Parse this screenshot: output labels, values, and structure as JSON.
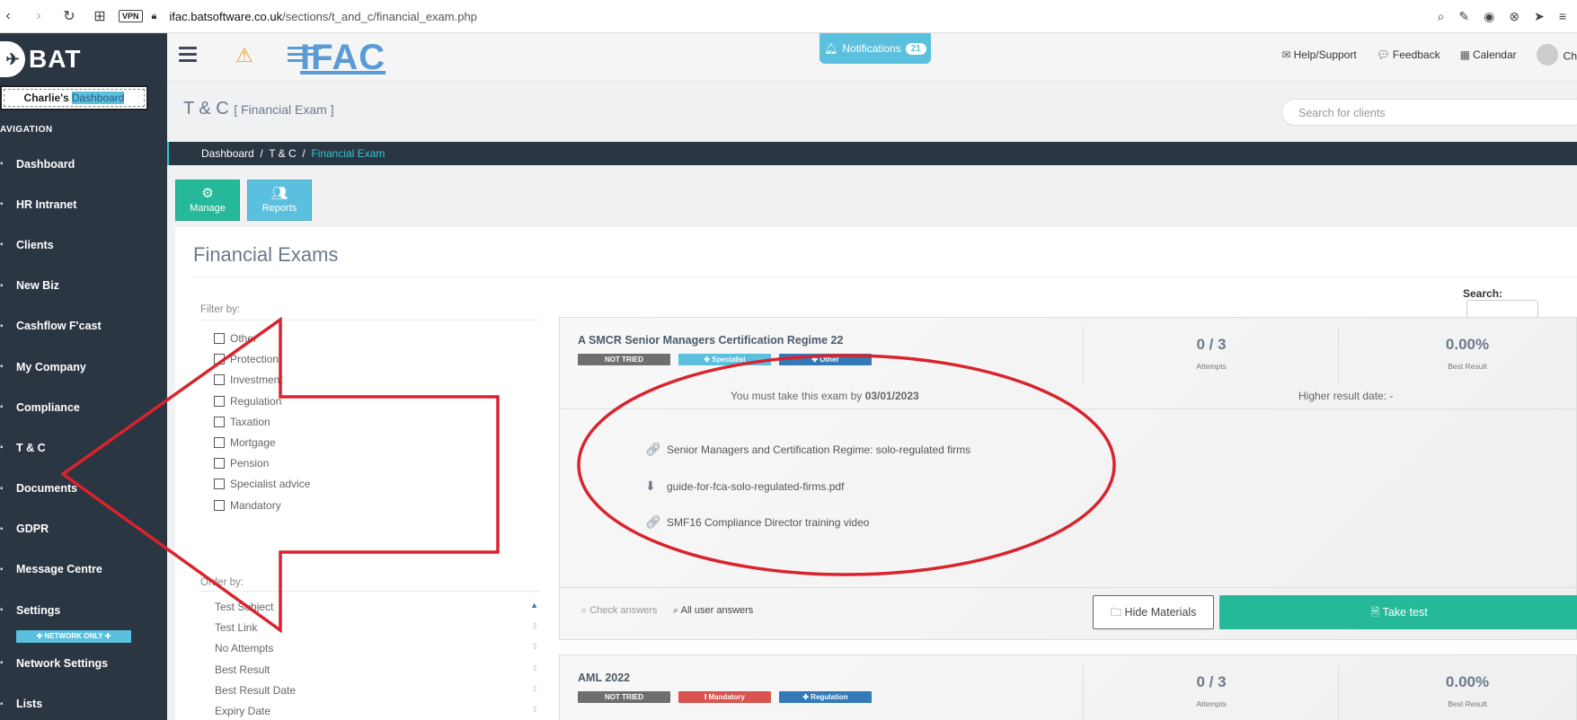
{
  "browser": {
    "url_host": "ifac.batsoftware.co.uk",
    "url_path": "/sections/t_and_c/financial_exam.php",
    "vpn_label": "VPN"
  },
  "sidebar": {
    "logo": "BAT",
    "dashboard_button": {
      "owner": "Charlie's",
      "label": "Dashboard"
    },
    "nav_heading": "AVIGATION",
    "items": [
      {
        "label": "Dashboard",
        "icon": "monitor-icon"
      },
      {
        "label": "HR Intranet",
        "icon": "hr-icon"
      },
      {
        "label": "Clients",
        "icon": "users-icon"
      },
      {
        "label": "New Biz",
        "icon": "sign-in-icon"
      },
      {
        "label": "Cashflow F'cast",
        "icon": "chart-icon"
      },
      {
        "label": "My Company",
        "icon": "building-icon"
      },
      {
        "label": "Compliance",
        "icon": "check-icon"
      },
      {
        "label": "T & C",
        "icon": "graduation-icon"
      },
      {
        "label": "Documents",
        "icon": "file-icon"
      },
      {
        "label": "GDPR",
        "icon": "shield-icon"
      },
      {
        "label": "Message Centre",
        "icon": "envelope-icon"
      },
      {
        "label": "Settings",
        "icon": "wrench-icon"
      }
    ],
    "network_only": "NETWORK ONLY",
    "items2": [
      {
        "label": "Network Settings",
        "icon": "sitemap-icon"
      },
      {
        "label": "Lists",
        "icon": "list-icon"
      }
    ]
  },
  "topbar": {
    "brand": "IFAC",
    "notifications_label": "Notifications",
    "notifications_count": "21",
    "links": {
      "help": "Help/Support",
      "feedback": "Feedback",
      "calendar": "Calendar",
      "user": "Ch"
    }
  },
  "page": {
    "title": "T & C",
    "subtitle": "[ Financial Exam ]",
    "search_placeholder": "Search for clients",
    "breadcrumb": {
      "home": "Dashboard",
      "section": "T & C",
      "current": "Financial Exam",
      "sep": "/"
    },
    "buttons": {
      "manage": "Manage",
      "reports": "Reports"
    },
    "panel_title": "Financial Exams",
    "search_label": "Search:"
  },
  "filters": {
    "label": "Filter by:",
    "options": [
      "Other",
      "Protection",
      "Investment",
      "Regulation",
      "Taxation",
      "Mortgage",
      "Pension",
      "Specialist advice",
      "Mandatory"
    ]
  },
  "order": {
    "label": "Order by:",
    "options": [
      "Test Subject",
      "Test Link",
      "No Attempts",
      "Best Result",
      "Best Result Date",
      "Expiry Date"
    ]
  },
  "exams": [
    {
      "title": "A SMCR Senior Managers Certification Regime 22",
      "tags": [
        {
          "label": "NOT TRIED",
          "color": "#6e6e6e"
        },
        {
          "label": "Specialist",
          "color": "#5bc0de"
        },
        {
          "label": "Other",
          "color": "#337ab7"
        }
      ],
      "attempts": "0 / 3",
      "attempts_label": "Attempts",
      "best": "0.00%",
      "best_label": "Best Result",
      "must_text": "You must take this exam by",
      "must_date": "03/01/2023",
      "higher": "Higher result date: -",
      "materials": [
        {
          "icon": "link-icon",
          "text": "Senior Managers and Certification Regime: solo-regulated firms"
        },
        {
          "icon": "download-icon",
          "text": "guide-for-fca-solo-regulated-firms.pdf"
        },
        {
          "icon": "link-icon",
          "text": "SMF16 Compliance Director training video"
        }
      ],
      "check_answers": "Check answers",
      "all_answers": "All user answers",
      "hide_materials": "Hide Materials",
      "take_test": "Take test"
    },
    {
      "title": "AML 2022",
      "tags": [
        {
          "label": "NOT TRIED",
          "color": "#6e6e6e"
        },
        {
          "label": "Mandatory",
          "color": "#d9534f"
        },
        {
          "label": "Regulation",
          "color": "#337ab7"
        }
      ],
      "attempts": "0 / 3",
      "attempts_label": "Attempts",
      "best": "0.00%",
      "best_label": "Best Result"
    }
  ],
  "annotation_color": "#d9232d"
}
